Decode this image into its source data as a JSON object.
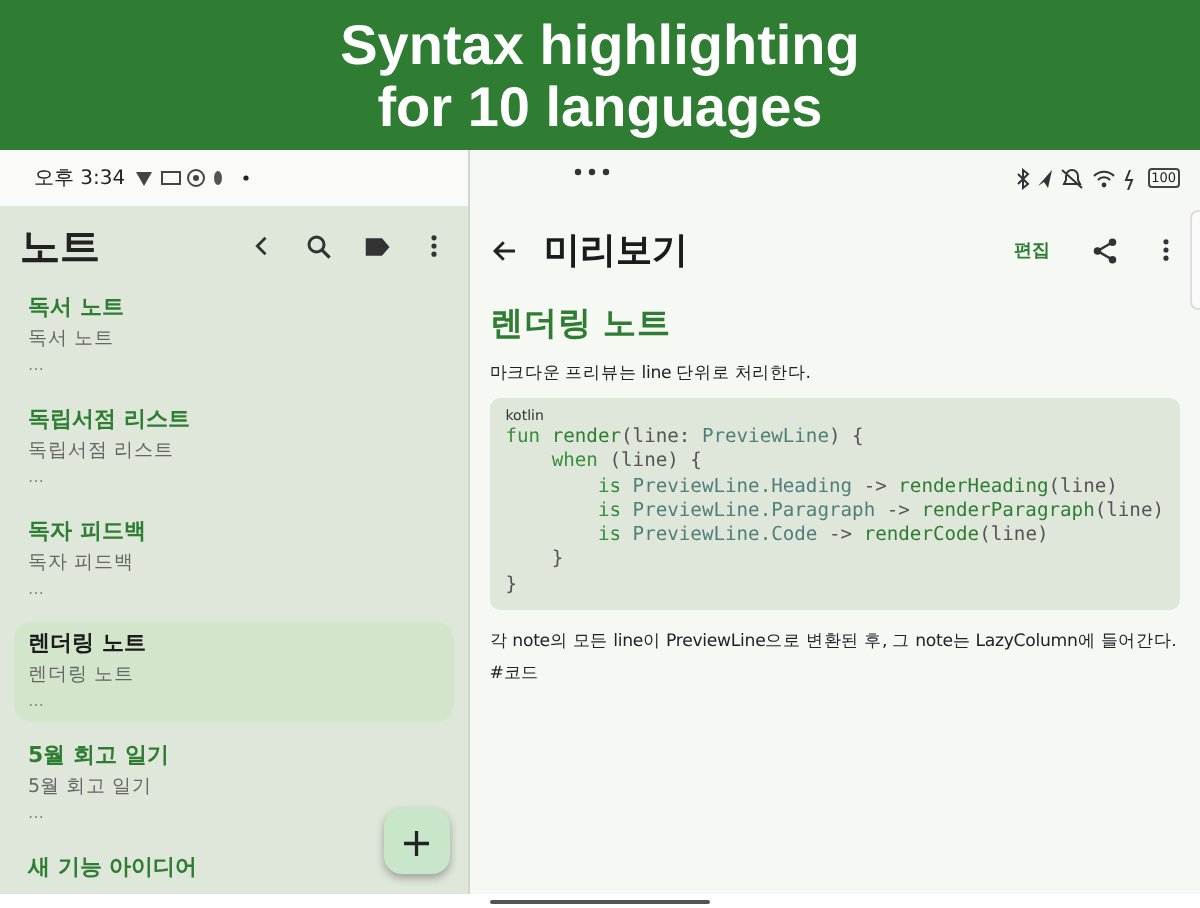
{
  "banner": {
    "title_lines": [
      "Syntax highlighting",
      "for 10 languages"
    ]
  },
  "status_bar": {
    "time": "오후 3:34",
    "battery": "100"
  },
  "list_pane": {
    "title": "노트",
    "notes": [
      {
        "title": "독서 노트",
        "preview": "독서 노트",
        "more": "…",
        "selected": false
      },
      {
        "title": "독립서점 리스트",
        "preview": "독립서점 리스트",
        "more": "…",
        "selected": false
      },
      {
        "title": "독자 피드백",
        "preview": "독자 피드백",
        "more": "…",
        "selected": false
      },
      {
        "title": "렌더링 노트",
        "preview": "렌더링 노트",
        "more": "…",
        "selected": true
      },
      {
        "title": "5월 회고 일기",
        "preview": "5월 회고 일기",
        "more": "…",
        "selected": false
      },
      {
        "title": "새 기능 아이디어",
        "selected": false
      }
    ],
    "fab": "+"
  },
  "preview_pane": {
    "title": "미리보기",
    "edit_button": "편집",
    "heading": "렌더링 노트",
    "paragraph": "마크다운 프리뷰는 line 단위로 처리한다.",
    "code_block": {
      "language": "kotlin",
      "lines": [
        [
          {
            "kind": "keyword",
            "text": "fun "
          },
          {
            "kind": "function",
            "text": "render"
          },
          {
            "kind": "plain",
            "text": "(line: "
          },
          {
            "kind": "type",
            "text": "PreviewLine"
          },
          {
            "kind": "plain",
            "text": ") {"
          }
        ],
        [
          {
            "kind": "keyword",
            "text": "    when"
          },
          {
            "kind": "plain",
            "text": " (line) {"
          }
        ],
        [
          {
            "kind": "keyword",
            "text": "        is "
          },
          {
            "kind": "type",
            "text": "PreviewLine.Heading"
          },
          {
            "kind": "plain",
            "text": " -> "
          },
          {
            "kind": "function",
            "text": "renderHeading"
          },
          {
            "kind": "plain",
            "text": "(line)"
          }
        ],
        [
          {
            "kind": "keyword",
            "text": "        is "
          },
          {
            "kind": "type",
            "text": "PreviewLine.Paragraph"
          },
          {
            "kind": "plain",
            "text": " -> "
          },
          {
            "kind": "function",
            "text": "renderParagraph"
          },
          {
            "kind": "plain",
            "text": "(line)"
          }
        ],
        [
          {
            "kind": "keyword",
            "text": "        is "
          },
          {
            "kind": "type",
            "text": "PreviewLine.Code"
          },
          {
            "kind": "plain",
            "text": " -> "
          },
          {
            "kind": "function",
            "text": "renderCode"
          },
          {
            "kind": "plain",
            "text": "(line)"
          }
        ],
        [
          {
            "kind": "plain",
            "text": "    }"
          }
        ],
        [
          {
            "kind": "plain",
            "text": "}"
          }
        ]
      ]
    },
    "body": "각 note의 모든 line이 PreviewLine으로 변환된 후, 그 note는 LazyColumn에 들어간다.",
    "tag": "#코드"
  }
}
